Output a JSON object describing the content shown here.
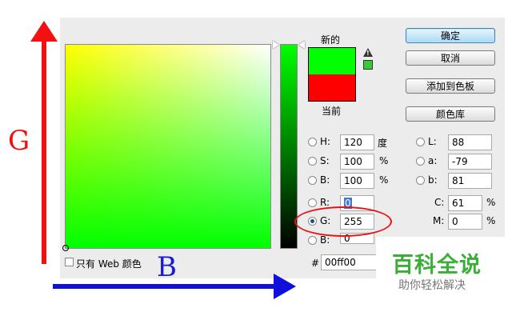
{
  "picker": {
    "new_label": "新的",
    "current_label": "当前",
    "new_color": "#00ff00",
    "current_color": "#ff0000",
    "websafe_color": "#33cc33",
    "web_only_label": "只有 Web 颜色",
    "hex_prefix": "#",
    "hex_value": "00ff00"
  },
  "buttons": {
    "ok": "确定",
    "cancel": "取消",
    "add_swatch": "添加到色板",
    "color_library": "颜色库"
  },
  "hsb": [
    {
      "label": "H:",
      "value": "120",
      "unit": "度"
    },
    {
      "label": "S:",
      "value": "100",
      "unit": "%"
    },
    {
      "label": "B:",
      "value": "100",
      "unit": "%"
    }
  ],
  "rgb": [
    {
      "label": "R:",
      "value": "0"
    },
    {
      "label": "G:",
      "value": "255"
    },
    {
      "label": "B:",
      "value": "0"
    }
  ],
  "lab": [
    {
      "label": "L:",
      "value": "88"
    },
    {
      "label": "a:",
      "value": "-79"
    },
    {
      "label": "b:",
      "value": "81"
    }
  ],
  "cmyk": [
    {
      "label": "C:",
      "value": "61",
      "unit": "%"
    },
    {
      "label": "M:",
      "value": "0",
      "unit": "%"
    }
  ],
  "annotations": {
    "vertical_axis": "G",
    "horizontal_axis": "B",
    "accent_red": "#f21010",
    "accent_blue": "#1010dd"
  },
  "watermark": {
    "title": "百科全说",
    "subtitle": "助你轻松解决"
  }
}
